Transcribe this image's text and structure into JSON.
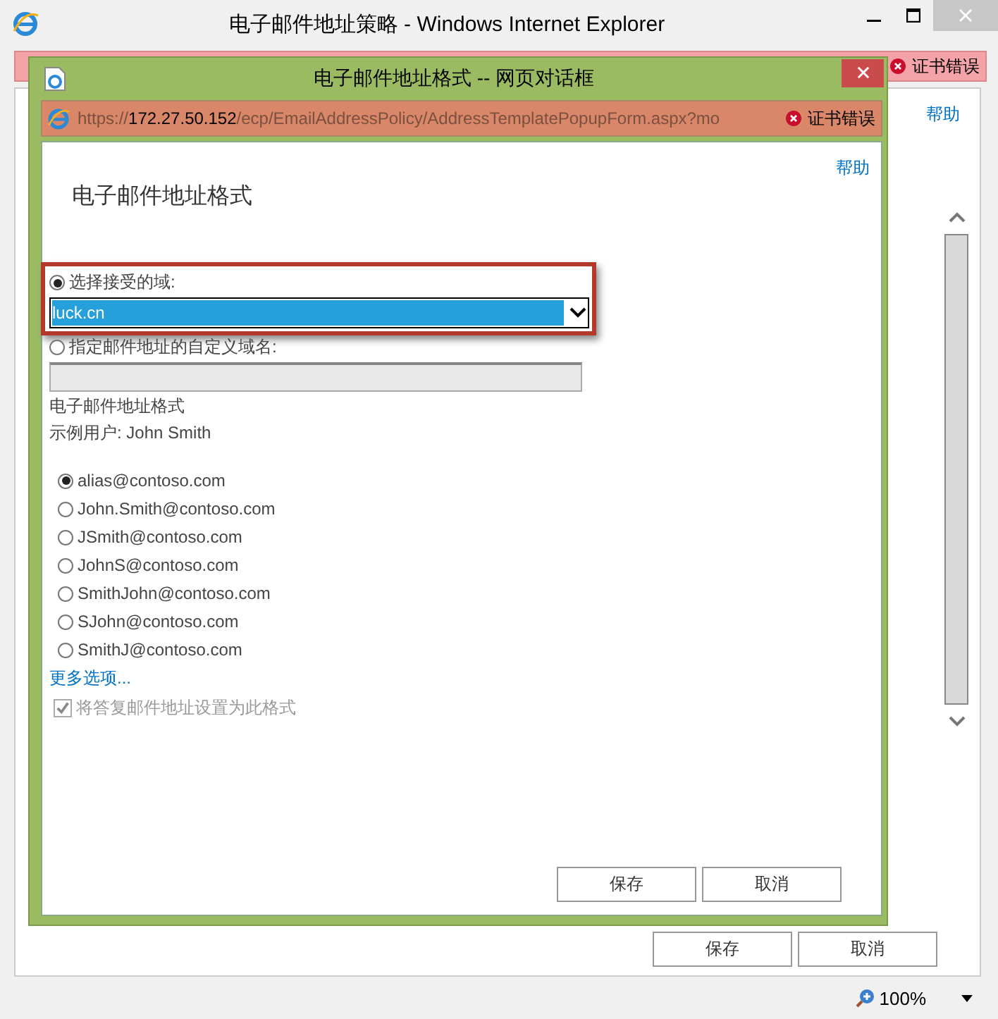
{
  "window": {
    "title": "电子邮件地址策略 - Windows Internet Explorer",
    "cert_error": "证书错误"
  },
  "page": {
    "help": "帮助",
    "buttons": [
      "保存",
      "取消"
    ],
    "zoom": "100%"
  },
  "dialog": {
    "title": "电子邮件地址格式 -- 网页对话框",
    "url": {
      "scheme": "https://",
      "host": "172.27.50.152",
      "path": "/ecp/EmailAddressPolicy/AddressTemplatePopupForm.aspx?mo"
    },
    "cert_error": "证书错误",
    "help": "帮助",
    "heading": "电子邮件地址格式",
    "domain_options": [
      {
        "kind": "dropdown",
        "label": "选择接受的域:",
        "selected": true,
        "value": "luck.cn",
        "highlighted": true
      },
      {
        "kind": "text",
        "label": "指定邮件地址的自定义域名:",
        "selected": false,
        "disabled": true,
        "highlighted": false
      }
    ],
    "format_label": "电子邮件地址格式",
    "example_user": "示例用户: John Smith",
    "formats": [
      {
        "label": "alias@contoso.com",
        "selected": true
      },
      {
        "label": "John.Smith@contoso.com",
        "selected": false
      },
      {
        "label": "JSmith@contoso.com",
        "selected": false
      },
      {
        "label": "JohnS@contoso.com",
        "selected": false
      },
      {
        "label": "SmithJohn@contoso.com",
        "selected": false
      },
      {
        "label": "SJohn@contoso.com",
        "selected": false
      },
      {
        "label": "SmithJ@contoso.com",
        "selected": false
      }
    ],
    "more_options": "更多选项...",
    "reply_checkbox": {
      "label": "将答复邮件地址设置为此格式",
      "checked": true,
      "disabled": true
    },
    "buttons": [
      "保存",
      "取消"
    ]
  }
}
